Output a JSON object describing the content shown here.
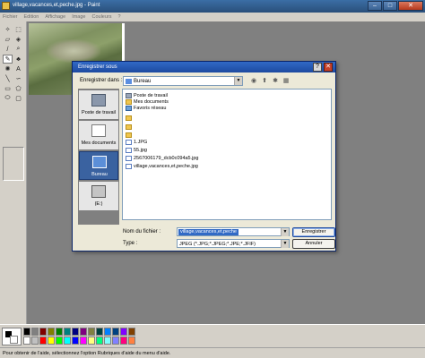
{
  "window": {
    "title": "village,vacances,et,peche.jpg - Paint"
  },
  "menu": [
    "Fichier",
    "Edition",
    "Affichage",
    "Image",
    "Couleurs",
    "?"
  ],
  "dialog": {
    "title": "Enregistrer sous",
    "save_in_label": "Enregistrer dans :",
    "save_in_value": "Bureau",
    "places": [
      "Poste de travail",
      "Mes documents",
      "Bureau",
      "(E:)"
    ],
    "files": [
      {
        "name": "Poste de travail",
        "icon": "computer-icon"
      },
      {
        "name": "Mes documents",
        "icon": "folder-icon"
      },
      {
        "name": "Favoris réseau",
        "icon": "network-icon"
      },
      {
        "name": "",
        "icon": "folder-icon"
      },
      {
        "name": "",
        "icon": "folder-icon"
      },
      {
        "name": "",
        "icon": "folder-icon"
      },
      {
        "name": "1.JPG",
        "icon": "image-icon"
      },
      {
        "name": "55.jpg",
        "icon": "image-icon"
      },
      {
        "name": "2567006179_dcb0c094a5.jpg",
        "icon": "image-icon"
      },
      {
        "name": "village,vacances,et,peche.jpg",
        "icon": "image-icon"
      }
    ],
    "filename_label": "Nom du fichier :",
    "filename_value": "village,vacances,et,peche",
    "type_label": "Type :",
    "type_value": "JPEG (*.JPG;*.JPEG;*.JPE;*.JFIF)",
    "save_button": "Enregistrer",
    "cancel_button": "Annuler"
  },
  "status": "Pour obtenir de l'aide, sélectionnez l'option Rubriques d'aide du menu d'aide.",
  "colors": {
    "palette_row1": [
      "#000000",
      "#808080",
      "#800000",
      "#808000",
      "#008000",
      "#008080",
      "#000080",
      "#800080",
      "#808040",
      "#004040",
      "#0080ff",
      "#004080",
      "#8000ff",
      "#804000"
    ],
    "palette_row2": [
      "#ffffff",
      "#c0c0c0",
      "#ff0000",
      "#ffff00",
      "#00ff00",
      "#00ffff",
      "#0000ff",
      "#ff00ff",
      "#ffff80",
      "#00ff80",
      "#80ffff",
      "#8080ff",
      "#ff0080",
      "#ff8040"
    ]
  }
}
